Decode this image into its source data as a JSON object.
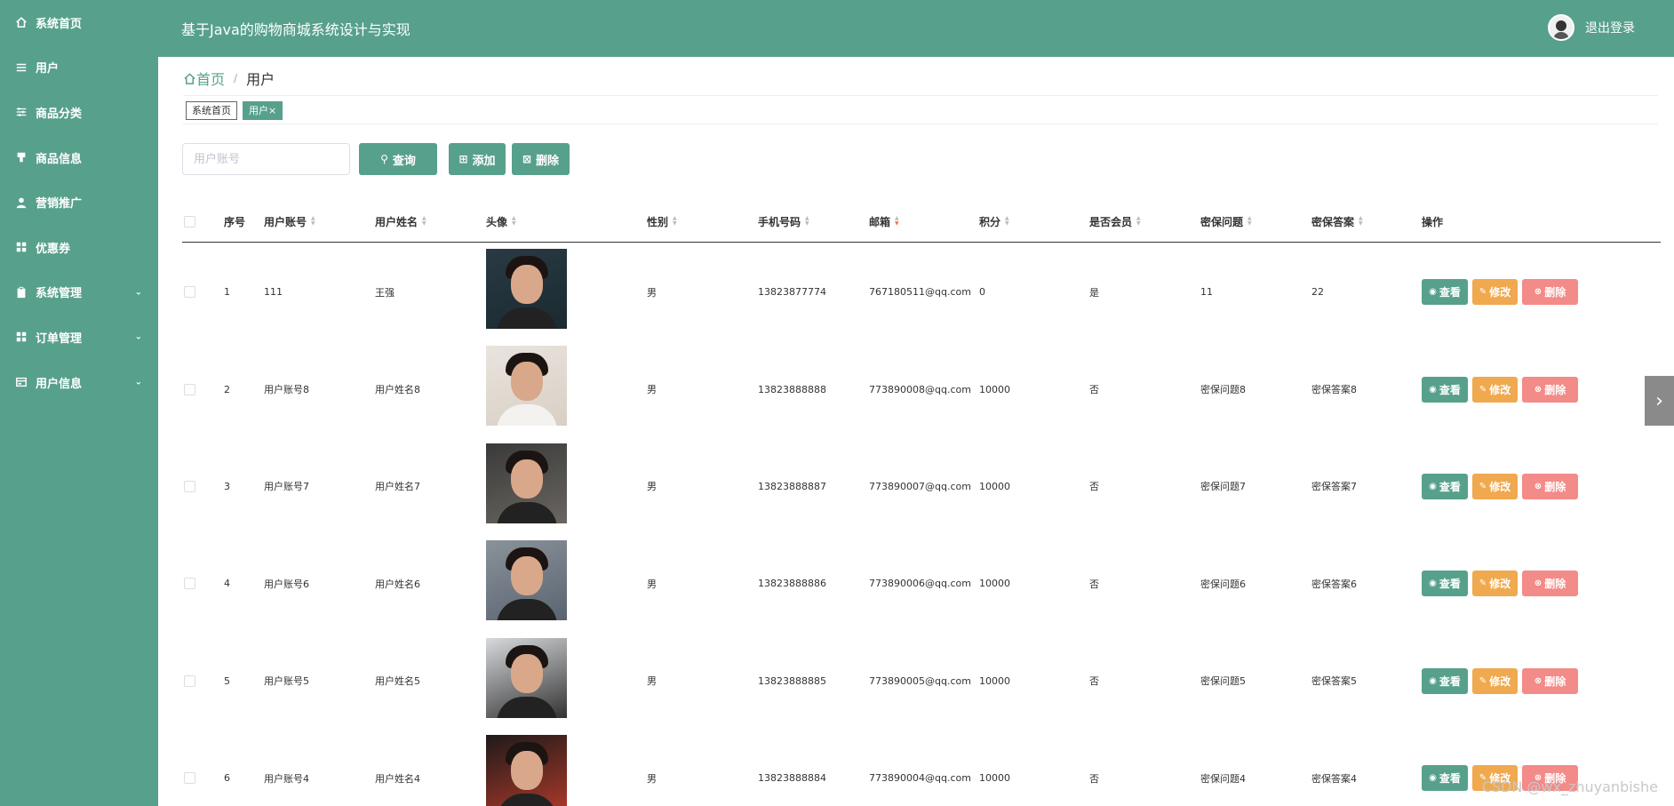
{
  "app": {
    "title": "基于Java的购物商城系统设计与实现",
    "logout": "退出登录"
  },
  "sidebar": {
    "items": [
      {
        "label": "系统首页",
        "icon": "home-icon",
        "expandable": false
      },
      {
        "label": "用户",
        "icon": "list-icon",
        "expandable": false
      },
      {
        "label": "商品分类",
        "icon": "sliders-icon",
        "expandable": false
      },
      {
        "label": "商品信息",
        "icon": "bookmark-icon",
        "expandable": false
      },
      {
        "label": "营销推广",
        "icon": "person-icon",
        "expandable": false
      },
      {
        "label": "优惠券",
        "icon": "grid-icon",
        "expandable": false
      },
      {
        "label": "系统管理",
        "icon": "clipboard-icon",
        "expandable": true
      },
      {
        "label": "订单管理",
        "icon": "grid-icon",
        "expandable": true
      },
      {
        "label": "用户信息",
        "icon": "card-icon",
        "expandable": true
      }
    ]
  },
  "breadcrumb": {
    "home": "首页",
    "sep": "/",
    "current": "用户"
  },
  "tags": [
    {
      "label": "系统首页"
    },
    {
      "label": "用户×"
    }
  ],
  "toolbar": {
    "search_placeholder": "用户账号",
    "query": "查询",
    "add": "添加",
    "delete": "删除"
  },
  "table": {
    "headers": {
      "index": "序号",
      "account": "用户账号",
      "name": "用户姓名",
      "avatar": "头像",
      "gender": "性别",
      "phone": "手机号码",
      "email": "邮箱",
      "points": "积分",
      "member": "是否会员",
      "question": "密保问题",
      "answer": "密保答案",
      "actions": "操作"
    },
    "row_actions": {
      "view": "查看",
      "edit": "修改",
      "delete": "删除"
    },
    "rows": [
      {
        "index": "1",
        "account": "111",
        "name": "王强",
        "gender": "男",
        "phone": "13823877774",
        "email": "767180511@qq.com",
        "points": "0",
        "member": "是",
        "question": "11",
        "answer": "22"
      },
      {
        "index": "2",
        "account": "用户账号8",
        "name": "用户姓名8",
        "gender": "男",
        "phone": "13823888888",
        "email": "773890008@qq.com",
        "points": "10000",
        "member": "否",
        "question": "密保问题8",
        "answer": "密保答案8"
      },
      {
        "index": "3",
        "account": "用户账号7",
        "name": "用户姓名7",
        "gender": "男",
        "phone": "13823888887",
        "email": "773890007@qq.com",
        "points": "10000",
        "member": "否",
        "question": "密保问题7",
        "answer": "密保答案7"
      },
      {
        "index": "4",
        "account": "用户账号6",
        "name": "用户姓名6",
        "gender": "男",
        "phone": "13823888886",
        "email": "773890006@qq.com",
        "points": "10000",
        "member": "否",
        "question": "密保问题6",
        "answer": "密保答案6"
      },
      {
        "index": "5",
        "account": "用户账号5",
        "name": "用户姓名5",
        "gender": "男",
        "phone": "13823888885",
        "email": "773890005@qq.com",
        "points": "10000",
        "member": "否",
        "question": "密保问题5",
        "answer": "密保答案5"
      },
      {
        "index": "6",
        "account": "用户账号4",
        "name": "用户姓名4",
        "gender": "男",
        "phone": "13823888884",
        "email": "773890004@qq.com",
        "points": "10000",
        "member": "否",
        "question": "密保问题4",
        "answer": "密保答案4"
      }
    ]
  },
  "watermark": "CSDN @wx_zhuyanbishe",
  "colors": {
    "primary": "#57a08c",
    "edit": "#f0a94f",
    "danger": "#f38b88"
  }
}
